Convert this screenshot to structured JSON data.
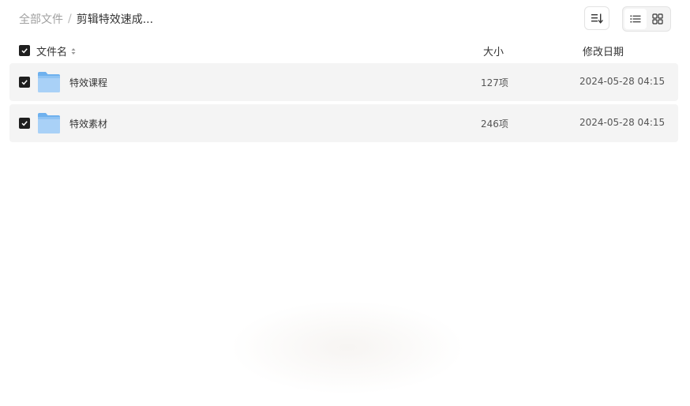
{
  "breadcrumb": {
    "root": "全部文件",
    "separator": "/",
    "current": "剪辑特效速成..."
  },
  "toolbar": {
    "sort_icon": "sort-lines-icon",
    "view_list_icon": "list-view-icon",
    "view_grid_icon": "grid-view-icon",
    "active_view": "list"
  },
  "header": {
    "name": "文件名",
    "size": "大小",
    "date": "修改日期"
  },
  "files": [
    {
      "name": "特效课程",
      "size": "127项",
      "modified": "2024-05-28 04:15",
      "checked": true
    },
    {
      "name": "特效素材",
      "size": "246项",
      "modified": "2024-05-28 04:15",
      "checked": true
    }
  ],
  "colors": {
    "row_bg": "#f4f4f4",
    "checkbox": "#1f1f1f",
    "folder_light": "#a9d1f7",
    "folder_dark": "#6fb1ee"
  }
}
